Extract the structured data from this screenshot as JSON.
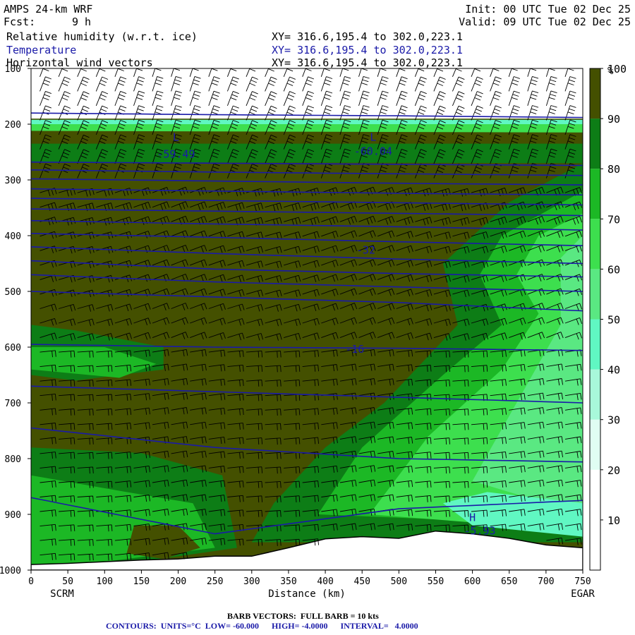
{
  "header": {
    "model": "AMPS 24-km WRF",
    "fcst_label": "Fcst:",
    "fcst_value": "9 h",
    "init": "Init: 00 UTC Tue 02 Dec 25",
    "valid": "Valid: 09 UTC Tue 02 Dec 25",
    "fields": [
      {
        "name": "Relative humidity (w.r.t. ice)",
        "xy": "XY= 316.6,195.4 to 302.0,223.1",
        "color": "#000000"
      },
      {
        "name": "Temperature",
        "xy": "XY= 316.6,195.4 to 302.0,223.1",
        "color": "#1a1aa8"
      },
      {
        "name": "Horizontal wind vectors",
        "xy": "XY= 316.6,195.4 to 302.0,223.1",
        "color": "#000000"
      }
    ]
  },
  "footer": {
    "barb": "BARB VECTORS:  FULL BARB = 10 kts",
    "contours": "CONTOURS:  UNITS=°C  LOW= -60.000      HIGH= -4.0000      INTERVAL=   4.0000"
  },
  "chart_data": {
    "type": "heatmap",
    "xlabel": "Distance (km)",
    "x_ticks": [
      0,
      50,
      100,
      150,
      200,
      250,
      300,
      350,
      400,
      450,
      500,
      550,
      600,
      650,
      700,
      750
    ],
    "xlim": [
      0,
      750
    ],
    "y_ticks": [
      100,
      200,
      300,
      400,
      500,
      600,
      700,
      800,
      900,
      1000
    ],
    "ylim": [
      1000,
      100
    ],
    "endpoints": {
      "left": "SCRM",
      "right": "EGAR"
    },
    "colorbar": {
      "unit": "%",
      "ticks": [
        10,
        20,
        30,
        40,
        50,
        60,
        70,
        80,
        90,
        100
      ],
      "colors": [
        "#ffffff",
        "#ffffff",
        "#e0fdf3",
        "#a8f8da",
        "#60f7c2",
        "#5ae882",
        "#3ddf4e",
        "#1cb825",
        "#0d7d16",
        "#445000"
      ]
    },
    "rh_bands": [
      {
        "level": "above_100",
        "color": "#445000"
      },
      {
        "level": "90-100",
        "color": "#0d7d16"
      },
      {
        "level": "80-90",
        "color": "#1cb825"
      },
      {
        "level": "70-80",
        "color": "#3ddf4e"
      },
      {
        "level": "60-70",
        "color": "#5ae882"
      },
      {
        "level": "50-60",
        "color": "#60f7c2"
      }
    ],
    "terrain": [
      [
        0,
        990
      ],
      [
        50,
        988
      ],
      [
        100,
        985
      ],
      [
        150,
        982
      ],
      [
        200,
        980
      ],
      [
        250,
        975
      ],
      [
        300,
        975
      ],
      [
        350,
        960
      ],
      [
        400,
        944
      ],
      [
        450,
        940
      ],
      [
        500,
        943
      ],
      [
        550,
        930
      ],
      [
        600,
        935
      ],
      [
        650,
        943
      ],
      [
        700,
        955
      ],
      [
        750,
        960
      ]
    ],
    "temperature_lines": [
      {
        "pressure": [
          180,
          183,
          185,
          188
        ]
      },
      {
        "pressure": [
          268,
          270,
          272,
          274
        ]
      },
      {
        "pressure": [
          282,
          286,
          289,
          292
        ]
      },
      {
        "pressure": [
          298,
          302,
          306,
          309
        ]
      },
      {
        "pressure": [
          316,
          320,
          324,
          327
        ]
      },
      {
        "pressure": [
          333,
          337,
          341,
          345
        ]
      },
      {
        "pressure": [
          352,
          356,
          360,
          364
        ]
      },
      {
        "pressure": [
          373,
          379,
          384,
          390
        ]
      },
      {
        "pressure": [
          396,
          403,
          411,
          418
        ]
      },
      {
        "pressure": [
          420,
          432,
          442,
          450
        ]
      },
      {
        "pressure": [
          445,
          460,
          468,
          474
        ]
      },
      {
        "pressure": [
          470,
          483,
          492,
          500
        ]
      },
      {
        "pressure": [
          500,
          510,
          520,
          535
        ]
      },
      {
        "pressure": [
          595,
          600,
          602,
          606
        ]
      },
      {
        "pressure": [
          670,
          680,
          690,
          700
        ]
      },
      {
        "pressure": [
          745,
          780,
          800,
          806
        ]
      },
      {
        "pressure": [
          870,
          935,
          890,
          875
        ]
      }
    ],
    "annotations": [
      {
        "text": "L",
        "x": 197,
        "p": 230
      },
      {
        "text": "-59.49",
        "x": 197,
        "p": 260
      },
      {
        "text": "L",
        "x": 465,
        "p": 230
      },
      {
        "text": "-60.04",
        "x": 465,
        "p": 255
      },
      {
        "text": "-32",
        "x": 455,
        "p": 432
      },
      {
        "text": "-16",
        "x": 440,
        "p": 610
      },
      {
        "text": "H",
        "x": 600,
        "p": 912
      },
      {
        "text": "-5.93",
        "x": 610,
        "p": 936
      }
    ]
  }
}
